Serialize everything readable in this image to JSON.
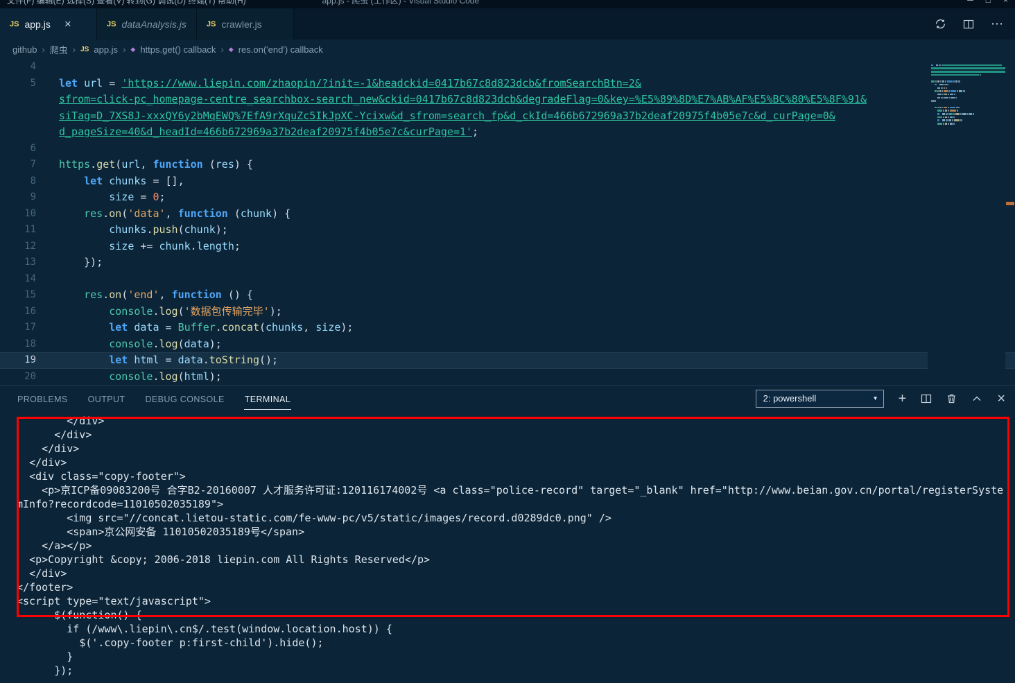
{
  "titlebar": {
    "menu": "文件(F)  编辑(E)  选择(S)  查看(V)  转到(G)  调试(D)  终端(T)  帮助(H)",
    "title": "app.js - 爬虫 (工作区) - Visual Studio Code"
  },
  "icons": {
    "js_badge": "JS",
    "tab_close": "×",
    "more": "⋯",
    "breadcrumb_sep": "›",
    "method_icon": "◆",
    "plus": "+",
    "close_x": "×",
    "caret_down": "▼",
    "win_min": "─",
    "win_max": "□",
    "win_close": "×"
  },
  "tabs": [
    {
      "label": "app.js",
      "active": true
    },
    {
      "label": "dataAnalysis.js",
      "preview": true
    },
    {
      "label": "crawler.js"
    }
  ],
  "breadcrumb": {
    "items": [
      "github",
      "爬虫",
      "app.js",
      "https.get() callback",
      "res.on('end') callback"
    ]
  },
  "editor": {
    "current_line": "19",
    "lines": [
      {
        "n": "4",
        "t": []
      },
      {
        "n": "5",
        "t": [
          [
            "k",
            "let"
          ],
          [
            "p",
            " "
          ],
          [
            "v",
            "url"
          ],
          [
            "p",
            " = "
          ],
          [
            "u",
            "'https://www.liepin.com/zhaopin/?init=-1&headckid=0417b67c8d823dcb&fromSearchBtn=2&"
          ]
        ]
      },
      {
        "n": "",
        "t": [
          [
            "u",
            "sfrom=click-pc_homepage-centre_searchbox-search_new&ckid=0417b67c8d823dcb&degradeFlag=0&key=%E5%89%8D%E7%AB%AF%E5%BC%80%E5%8F%91&"
          ]
        ]
      },
      {
        "n": "",
        "t": [
          [
            "u",
            "siTag=D_7XS8J-xxxQY6y2bMqEWQ%7EfA9rXquZc5IkJpXC-Ycixw&d_sfrom=search_fp&d_ckId=466b672969a37b2deaf20975f4b05e7c&d_curPage=0&"
          ]
        ]
      },
      {
        "n": "",
        "t": [
          [
            "u",
            "d_pageSize=40&d_headId=466b672969a37b2deaf20975f4b05e7c&curPage=1'"
          ],
          [
            "p",
            ";"
          ]
        ]
      },
      {
        "n": "6",
        "t": []
      },
      {
        "n": "7",
        "t": [
          [
            "o",
            "https"
          ],
          [
            "p",
            "."
          ],
          [
            "f",
            "get"
          ],
          [
            "p",
            "("
          ],
          [
            "v",
            "url"
          ],
          [
            "p",
            ", "
          ],
          [
            "k",
            "function"
          ],
          [
            "p",
            " ("
          ],
          [
            "v",
            "res"
          ],
          [
            "p",
            ") {"
          ]
        ]
      },
      {
        "n": "8",
        "t": [
          [
            "p",
            "    "
          ],
          [
            "k",
            "let"
          ],
          [
            "p",
            " "
          ],
          [
            "v",
            "chunks"
          ],
          [
            "p",
            " = [],"
          ]
        ]
      },
      {
        "n": "9",
        "t": [
          [
            "p",
            "        "
          ],
          [
            "v",
            "size"
          ],
          [
            "p",
            " = "
          ],
          [
            "n",
            "0"
          ],
          [
            "p",
            ";"
          ]
        ]
      },
      {
        "n": "10",
        "t": [
          [
            "p",
            "    "
          ],
          [
            "o",
            "res"
          ],
          [
            "p",
            "."
          ],
          [
            "f",
            "on"
          ],
          [
            "p",
            "("
          ],
          [
            "s",
            "'data'"
          ],
          [
            "p",
            ", "
          ],
          [
            "k",
            "function"
          ],
          [
            "p",
            " ("
          ],
          [
            "v",
            "chunk"
          ],
          [
            "p",
            ") {"
          ]
        ]
      },
      {
        "n": "11",
        "t": [
          [
            "p",
            "        "
          ],
          [
            "v",
            "chunks"
          ],
          [
            "p",
            "."
          ],
          [
            "f",
            "push"
          ],
          [
            "p",
            "("
          ],
          [
            "v",
            "chunk"
          ],
          [
            "p",
            ");"
          ]
        ]
      },
      {
        "n": "12",
        "t": [
          [
            "p",
            "        "
          ],
          [
            "v",
            "size"
          ],
          [
            "p",
            " += "
          ],
          [
            "v",
            "chunk"
          ],
          [
            "p",
            "."
          ],
          [
            "v",
            "length"
          ],
          [
            "p",
            ";"
          ]
        ]
      },
      {
        "n": "13",
        "t": [
          [
            "p",
            "    });"
          ]
        ]
      },
      {
        "n": "14",
        "t": []
      },
      {
        "n": "15",
        "t": [
          [
            "p",
            "    "
          ],
          [
            "o",
            "res"
          ],
          [
            "p",
            "."
          ],
          [
            "f",
            "on"
          ],
          [
            "p",
            "("
          ],
          [
            "s",
            "'end'"
          ],
          [
            "p",
            ", "
          ],
          [
            "k",
            "function"
          ],
          [
            "p",
            " () {"
          ]
        ]
      },
      {
        "n": "16",
        "t": [
          [
            "p",
            "        "
          ],
          [
            "o",
            "console"
          ],
          [
            "p",
            "."
          ],
          [
            "f",
            "log"
          ],
          [
            "p",
            "("
          ],
          [
            "s",
            "'数据包传输完毕'"
          ],
          [
            "p",
            ");"
          ]
        ]
      },
      {
        "n": "17",
        "t": [
          [
            "p",
            "        "
          ],
          [
            "k",
            "let"
          ],
          [
            "p",
            " "
          ],
          [
            "v",
            "data"
          ],
          [
            "p",
            " = "
          ],
          [
            "o",
            "Buffer"
          ],
          [
            "p",
            "."
          ],
          [
            "f",
            "concat"
          ],
          [
            "p",
            "("
          ],
          [
            "v",
            "chunks"
          ],
          [
            "p",
            ", "
          ],
          [
            "v",
            "size"
          ],
          [
            "p",
            ");"
          ]
        ]
      },
      {
        "n": "18",
        "t": [
          [
            "p",
            "        "
          ],
          [
            "o",
            "console"
          ],
          [
            "p",
            "."
          ],
          [
            "f",
            "log"
          ],
          [
            "p",
            "("
          ],
          [
            "v",
            "data"
          ],
          [
            "p",
            ");"
          ]
        ]
      },
      {
        "n": "19",
        "cur": true,
        "t": [
          [
            "p",
            "        "
          ],
          [
            "k",
            "let"
          ],
          [
            "p",
            " "
          ],
          [
            "v",
            "html"
          ],
          [
            "p",
            " = "
          ],
          [
            "v",
            "data"
          ],
          [
            "p",
            "."
          ],
          [
            "f",
            "toString"
          ],
          [
            "p",
            "();"
          ]
        ]
      },
      {
        "n": "20",
        "t": [
          [
            "p",
            "        "
          ],
          [
            "o",
            "console"
          ],
          [
            "p",
            "."
          ],
          [
            "f",
            "log"
          ],
          [
            "p",
            "("
          ],
          [
            "v",
            "html"
          ],
          [
            "p",
            ");"
          ]
        ]
      }
    ]
  },
  "panel": {
    "tabs": [
      "PROBLEMS",
      "OUTPUT",
      "DEBUG CONSOLE",
      "TERMINAL"
    ],
    "active_tab": "TERMINAL",
    "shell_label": "2: powershell",
    "terminal_lines": [
      "        </div>",
      "      </div>",
      "    </div>",
      "  </div>",
      "  <div class=\"copy-footer\">",
      "    <p>京ICP备09083200号 合字B2-20160007 人才服务许可证:120116174002号 <a class=\"police-record\" target=\"_blank\" href=\"http://www.beian.gov.cn/portal/registerSystemInfo?recordcode=11010502035189\">",
      "        <img src=\"//concat.lietou-static.com/fe-www-pc/v5/static/images/record.d0289dc0.png\" />",
      "        <span>京公网安备 11010502035189号</span>",
      "    </a></p>",
      "  <p>Copyright &copy; 2006-2018 liepin.com All Rights Reserved</p>",
      "  </div>",
      "</footer>",
      "<script type=\"text/javascript\">",
      "      $(function() {",
      "        if (/www\\.liepin\\.cn$/.test(window.location.host)) {",
      "          $('.copy-footer p:first-child').hide();",
      "        }",
      "      });"
    ]
  },
  "colors": {
    "editor_bg": "#0B2437",
    "tabbar_bg": "#061A2B",
    "annotation_red": "#FF0000",
    "js_icon_yellow": "#F2D766",
    "url_link_teal": "#2EC5A4",
    "keyword_blue": "#4FA7F8",
    "string_orange": "#E8A763",
    "overview_ruler_orange": "#C0703C"
  }
}
